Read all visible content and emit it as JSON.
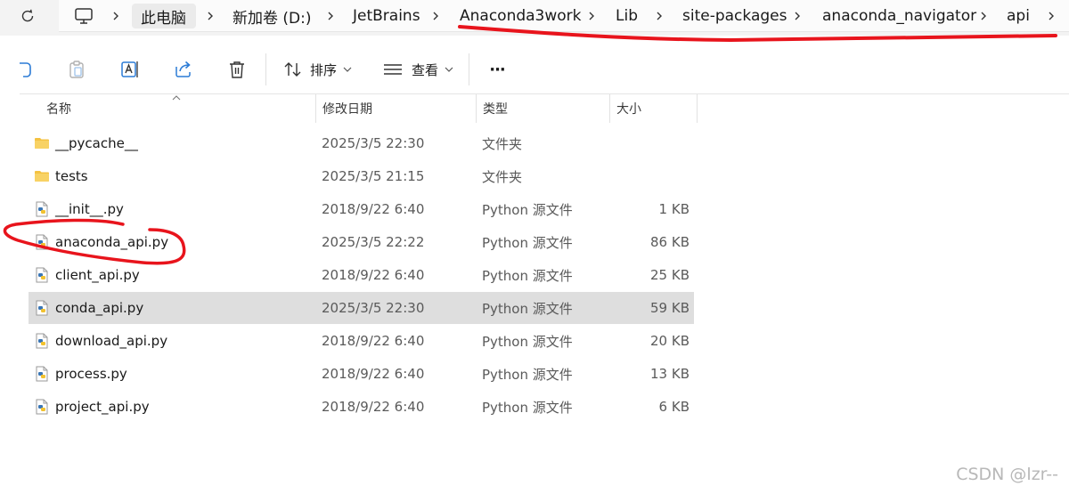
{
  "breadcrumb": [
    {
      "label": "此电脑"
    },
    {
      "label": "新加卷 (D:)"
    },
    {
      "label": "JetBrains"
    },
    {
      "label": "Anaconda3work"
    },
    {
      "label": "Lib"
    },
    {
      "label": "site-packages"
    },
    {
      "label": "anaconda_navigator"
    },
    {
      "label": "api"
    }
  ],
  "toolbar": {
    "sort_label": "排序",
    "view_label": "查看",
    "more_label": "···"
  },
  "columns": {
    "name": "名称",
    "date": "修改日期",
    "type": "类型",
    "size": "大小"
  },
  "files": [
    {
      "name": "__pycache__",
      "date": "2025/3/5 22:30",
      "type": "文件夹",
      "size": "",
      "kind": "folder"
    },
    {
      "name": "tests",
      "date": "2025/3/5 21:15",
      "type": "文件夹",
      "size": "",
      "kind": "folder"
    },
    {
      "name": "__init__.py",
      "date": "2018/9/22 6:40",
      "type": "Python 源文件",
      "size": "1 KB",
      "kind": "python"
    },
    {
      "name": "anaconda_api.py",
      "date": "2025/3/5 22:22",
      "type": "Python 源文件",
      "size": "86 KB",
      "kind": "python"
    },
    {
      "name": "client_api.py",
      "date": "2018/9/22 6:40",
      "type": "Python 源文件",
      "size": "25 KB",
      "kind": "python"
    },
    {
      "name": "conda_api.py",
      "date": "2025/3/5 22:30",
      "type": "Python 源文件",
      "size": "59 KB",
      "kind": "python",
      "selected": true
    },
    {
      "name": "download_api.py",
      "date": "2018/9/22 6:40",
      "type": "Python 源文件",
      "size": "20 KB",
      "kind": "python"
    },
    {
      "name": "process.py",
      "date": "2018/9/22 6:40",
      "type": "Python 源文件",
      "size": "13 KB",
      "kind": "python"
    },
    {
      "name": "project_api.py",
      "date": "2018/9/22 6:40",
      "type": "Python 源文件",
      "size": "6 KB",
      "kind": "python"
    }
  ],
  "watermark": "CSDN @lzr--",
  "colors": {
    "folder": "#f4c242",
    "python_blue": "#3a76b5",
    "python_yellow": "#f2c230",
    "selection": "#dedede",
    "annotation": "#e8141c"
  }
}
